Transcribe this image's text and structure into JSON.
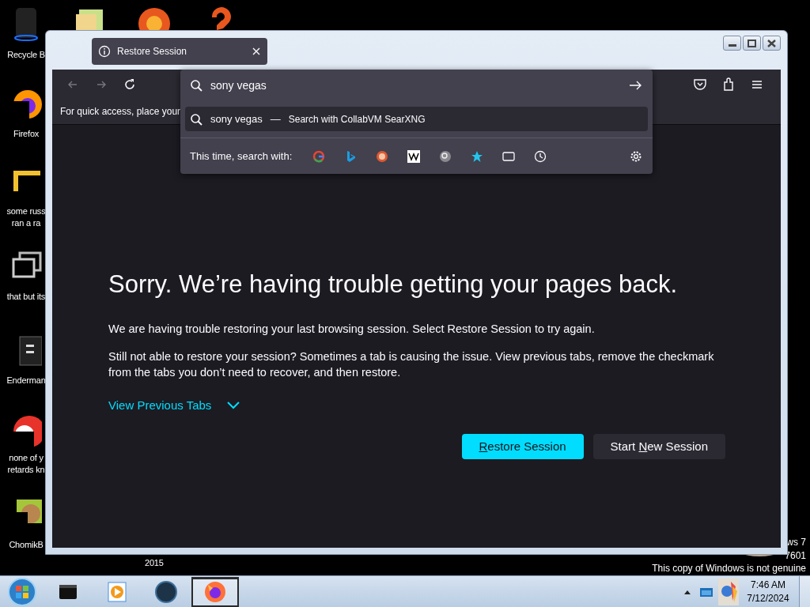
{
  "desktop": {
    "icons": [
      {
        "lines": [
          "Recycle B"
        ]
      },
      {
        "lines": [
          "Firefox"
        ]
      },
      {
        "lines": [
          "some russ",
          "ran a ra"
        ]
      },
      {
        "lines": [
          "that but its"
        ]
      },
      {
        "lines": [
          "Enderman"
        ]
      },
      {
        "lines": [
          "none of y",
          "retards kn"
        ]
      },
      {
        "lines": [
          "ChomikB"
        ]
      }
    ],
    "hidden_icon_label": "2015",
    "watermark": [
      "ws 7",
      "7601",
      "This copy of Windows is not genuine"
    ]
  },
  "window": {
    "tabs": [
      {
        "title": "Restore Session",
        "selected": true
      }
    ],
    "url_bar": {
      "value": "sony vegas"
    },
    "suggestions": [
      {
        "query": "sony vegas",
        "separator": "—",
        "action": "Search with CollabVM SearXNG",
        "selected": true
      }
    ],
    "search_with_label": "This time, search with:",
    "bookmarks_hint": "For quick access, place your",
    "page": {
      "heading": "Sorry. We’re having trouble getting your pages back.",
      "paragraphs": [
        "We are having trouble restoring your last browsing session. Select Restore Session to try again.",
        "Still not able to restore your session? Sometimes a tab is causing the issue. View previous tabs, remove the checkmark from the tabs you don’t need to recover, and then restore."
      ],
      "toggle": {
        "label": "View Previous Tabs",
        "expanded": false
      },
      "buttons": [
        {
          "label_parts": [
            {
              "text": "R",
              "underlined": true
            },
            {
              "text": "estore Session",
              "underlined": false
            }
          ],
          "primary": true
        },
        {
          "label_parts": [
            {
              "text": "Start ",
              "underlined": false
            },
            {
              "text": "N",
              "underlined": true
            },
            {
              "text": "ew Session",
              "underlined": false
            }
          ],
          "primary": false
        }
      ]
    }
  },
  "taskbar": {
    "apps": [
      {
        "active": false
      },
      {
        "active": false
      },
      {
        "active": false
      },
      {
        "active": true
      }
    ],
    "clock": {
      "time": "7:46 AM",
      "date": "7/12/2024"
    }
  }
}
